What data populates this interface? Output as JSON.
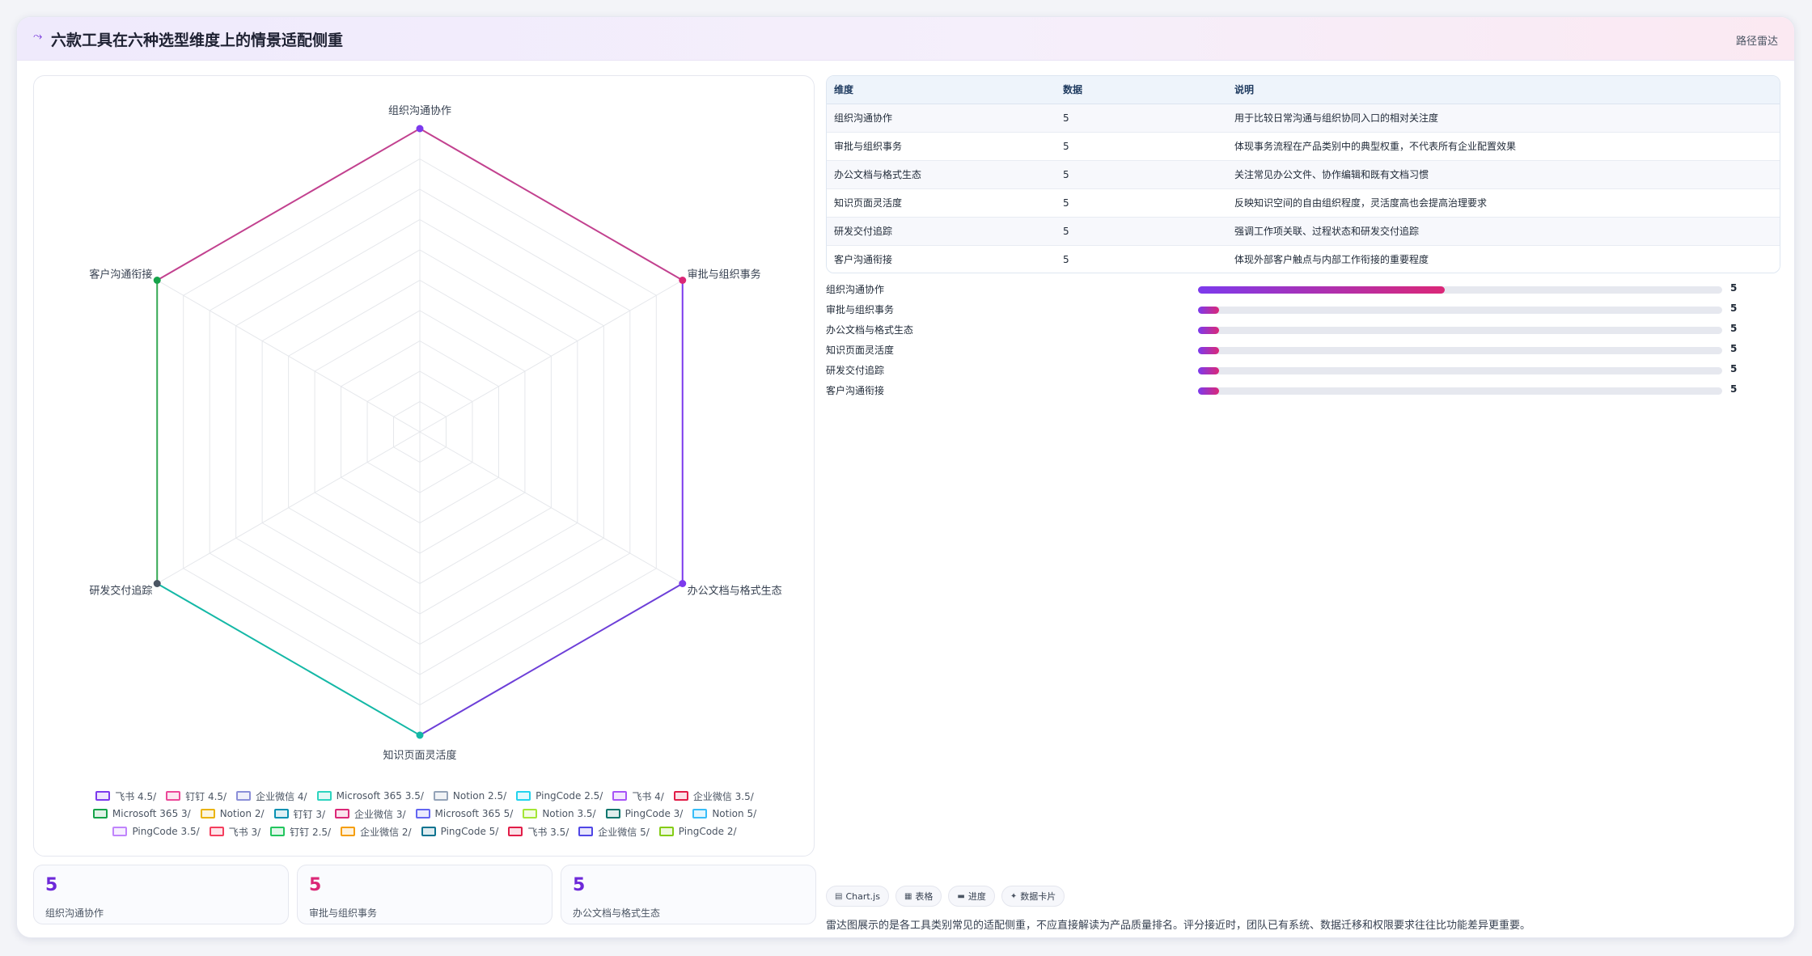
{
  "header": {
    "icon": "route-icon",
    "title": "六款工具在六种选型维度上的情景适配侧重",
    "tag": "路径雷达"
  },
  "chart_data": {
    "type": "radar",
    "title": "",
    "axes": [
      "组织沟通协作",
      "审批与组织事务",
      "办公文档与格式生态",
      "知识页面灵活度",
      "研发交付追踪",
      "客户沟通衔接"
    ],
    "r_range": [
      0,
      5
    ],
    "grid_levels": 10,
    "legend_position": "bottom",
    "series": [
      {
        "name": "飞书 4.5/",
        "color": "#7c3aed"
      },
      {
        "name": "钉钉 4.5/",
        "color": "#ec4899"
      },
      {
        "name": "企业微信 4/",
        "color": "#8b8fd8"
      },
      {
        "name": "Microsoft 365 3.5/",
        "color": "#2dd4bf"
      },
      {
        "name": "Notion 2.5/",
        "color": "#94a3b8"
      },
      {
        "name": "PingCode 2.5/",
        "color": "#22d3ee"
      },
      {
        "name": "飞书 4/",
        "color": "#a855f7"
      },
      {
        "name": "企业微信 3.5/",
        "color": "#e11d48"
      },
      {
        "name": "Microsoft 365 3/",
        "color": "#16a34a"
      },
      {
        "name": "Notion 2/",
        "color": "#eab308"
      },
      {
        "name": "钉钉 3/",
        "color": "#0891b2"
      },
      {
        "name": "企业微信 3/",
        "color": "#db2777"
      },
      {
        "name": "Microsoft 365 5/",
        "color": "#6366f1"
      },
      {
        "name": "Notion 3.5/",
        "color": "#a3e635"
      },
      {
        "name": "PingCode 3/",
        "color": "#0f766e"
      },
      {
        "name": "Notion 5/",
        "color": "#38bdf8"
      },
      {
        "name": "PingCode 3.5/",
        "color": "#c084fc"
      },
      {
        "name": "飞书 3/",
        "color": "#f43f5e"
      },
      {
        "name": "钉钉 2.5/",
        "color": "#22c55e"
      },
      {
        "name": "企业微信 2/",
        "color": "#f59e0b"
      },
      {
        "name": "PingCode 5/",
        "color": "#0e7490"
      },
      {
        "name": "飞书 3.5/",
        "color": "#e11d48"
      },
      {
        "name": "企业微信 5/",
        "color": "#4f46e5"
      },
      {
        "name": "PingCode 2/",
        "color": "#84cc16"
      }
    ],
    "outline": {
      "values": [
        5,
        5,
        5,
        5,
        5,
        5
      ],
      "edge_colors": [
        "#c2418f",
        "#7c3aed",
        "#6d3fd8",
        "#14b8a6",
        "#34a853",
        "#c2418f"
      ],
      "point_colors": [
        "#7c3aed",
        "#db2777",
        "#7c3aed",
        "#14b8a6",
        "#4b5563",
        "#16a34a"
      ]
    }
  },
  "stats": [
    {
      "value": "5",
      "label": "组织沟通协作",
      "color": "#6d28d9"
    },
    {
      "value": "5",
      "label": "审批与组织事务",
      "color": "#db2777"
    },
    {
      "value": "5",
      "label": "办公文档与格式生态",
      "color": "#6d28d9"
    }
  ],
  "table": {
    "headers": [
      "维度",
      "数据",
      "说明"
    ],
    "rows": [
      [
        "组织沟通协作",
        "5",
        "用于比较日常沟通与组织协同入口的相对关注度"
      ],
      [
        "审批与组织事务",
        "5",
        "体现事务流程在产品类别中的典型权重，不代表所有企业配置效果"
      ],
      [
        "办公文档与格式生态",
        "5",
        "关注常见办公文件、协作编辑和既有文档习惯"
      ],
      [
        "知识页面灵活度",
        "5",
        "反映知识空间的自由组织程度，灵活度高也会提高治理要求"
      ],
      [
        "研发交付追踪",
        "5",
        "强调工作项关联、过程状态和研发交付追踪"
      ],
      [
        "客户沟通衔接",
        "5",
        "体现外部客户触点与内部工作衔接的重要程度"
      ]
    ]
  },
  "bars": [
    {
      "label": "组织沟通协作",
      "value": "5",
      "fraction": 0.47
    },
    {
      "label": "审批与组织事务",
      "value": "5",
      "fraction": 0.04
    },
    {
      "label": "办公文档与格式生态",
      "value": "5",
      "fraction": 0.04
    },
    {
      "label": "知识页面灵活度",
      "value": "5",
      "fraction": 0.04
    },
    {
      "label": "研发交付追踪",
      "value": "5",
      "fraction": 0.04
    },
    {
      "label": "客户沟通衔接",
      "value": "5",
      "fraction": 0.04
    }
  ],
  "chips": [
    {
      "icon": "chart-icon",
      "glyph": "▤",
      "label": "Chart.js"
    },
    {
      "icon": "table-icon",
      "glyph": "▦",
      "label": "表格"
    },
    {
      "icon": "progress-icon",
      "glyph": "▬",
      "label": "进度"
    },
    {
      "icon": "card-icon",
      "glyph": "✦",
      "label": "数据卡片"
    }
  ],
  "footnote": "雷达图展示的是各工具类别常见的适配侧重，不应直接解读为产品质量排名。评分接近时，团队已有系统、数据迁移和权限要求往往比功能差异更重要。"
}
